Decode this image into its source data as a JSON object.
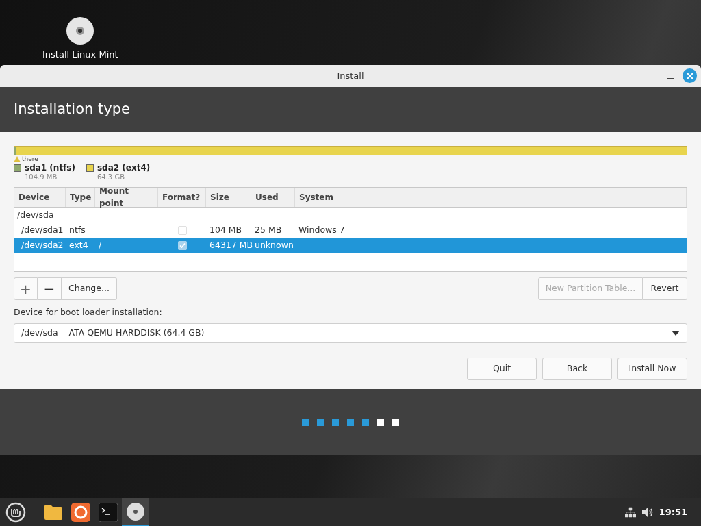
{
  "desktop_icons": [
    {
      "label": "Install Linux Mint"
    }
  ],
  "window": {
    "title": "Install",
    "heading": "Installation type"
  },
  "partition_bar": {
    "warning": "there",
    "legend": [
      {
        "name": "sda1 (ntfs)",
        "size": "104.9 MB",
        "color": "#8fa86e",
        "level": 0.002
      },
      {
        "name": "sda2 (ext4)",
        "size": "64.3 GB",
        "color": "#e8d44d",
        "level": 0.998
      }
    ]
  },
  "table": {
    "columns": [
      "Device",
      "Type",
      "Mount point",
      "Format?",
      "Size",
      "Used",
      "System"
    ],
    "rows": [
      {
        "kind": "disk",
        "device": "/dev/sda",
        "selected": false
      },
      {
        "kind": "partition",
        "device": "/dev/sda1",
        "type": "ntfs",
        "mount": "",
        "format": false,
        "size": "104 MB",
        "used": "25 MB",
        "system": "Windows 7",
        "selected": false
      },
      {
        "kind": "partition",
        "device": "/dev/sda2",
        "type": "ext4",
        "mount": "/",
        "format": true,
        "size": "64317 MB",
        "used": "unknown",
        "system": "",
        "selected": true
      }
    ]
  },
  "toolbar": {
    "plus": "+",
    "minus": "−",
    "change": "Change...",
    "new_table": {
      "label": "New Partition Table...",
      "disabled": true
    },
    "revert": {
      "label": "Revert",
      "disabled": false
    }
  },
  "boot_loader": {
    "label": "Device for boot loader installation:",
    "device": "/dev/sda",
    "description": "ATA QEMU HARDDISK (64.4 GB)"
  },
  "buttons": [
    "Quit",
    "Back",
    "Install Now"
  ],
  "progress_steps": [
    {
      "done": true
    },
    {
      "done": true
    },
    {
      "done": true
    },
    {
      "done": true
    },
    {
      "done": true
    },
    {
      "done": false
    },
    {
      "done": false
    }
  ],
  "taskbar": {
    "apps": [
      {
        "kind": "folder",
        "active": false
      },
      {
        "kind": "browser",
        "active": false
      },
      {
        "kind": "terminal",
        "active": false
      },
      {
        "kind": "disc",
        "active": true
      }
    ],
    "clock": "19:51"
  }
}
